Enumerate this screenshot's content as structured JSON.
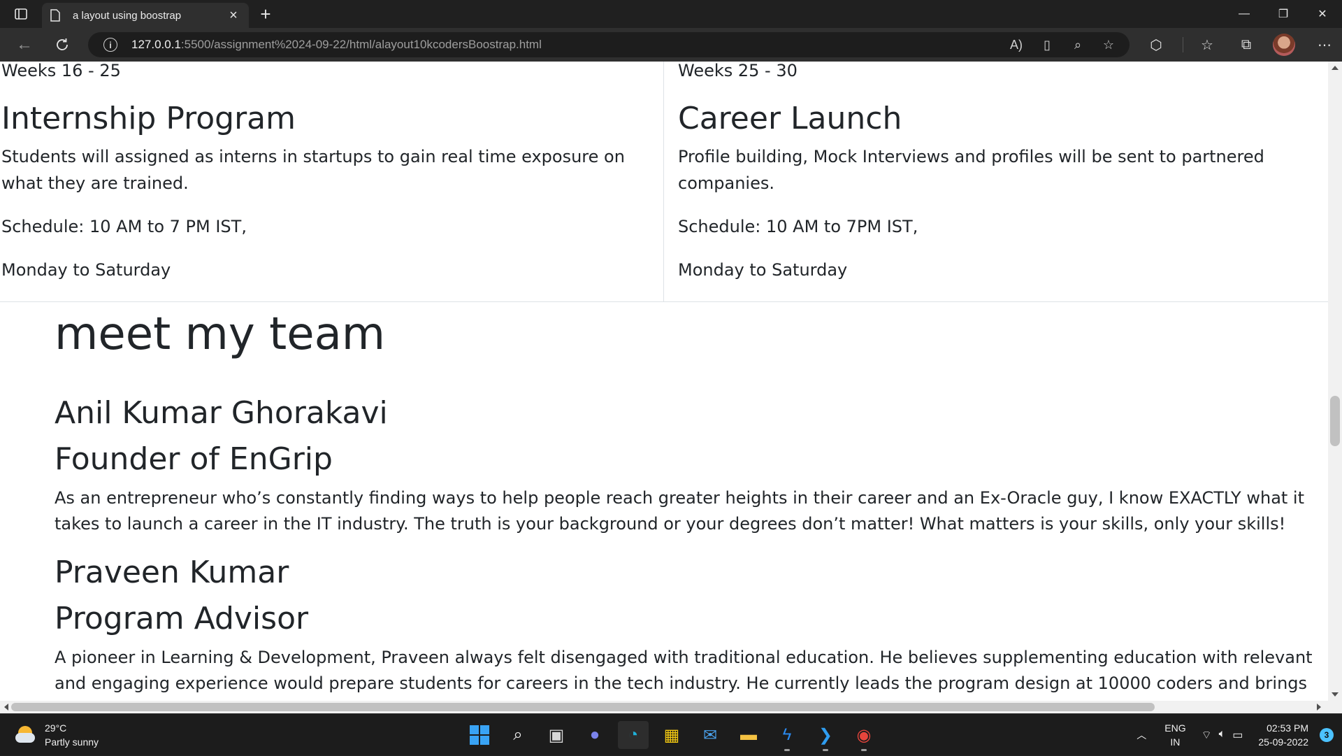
{
  "browser": {
    "tab_title": "a layout using boostrap",
    "url_host": "127.0.0.1",
    "url_rest": ":5500/assignment%2024-09-22/html/alayout10kcodersBoostrap.html"
  },
  "page": {
    "left_col": {
      "weeks": "Weeks 16 - 25",
      "heading": "Internship Program",
      "description": "Students will assigned as interns in startups to gain real time exposure on what they are trained.",
      "schedule": "Schedule: 10 AM to 7 PM IST,",
      "days": "Monday to Saturday"
    },
    "right_col": {
      "weeks": "Weeks 25 - 30",
      "heading": "Career Launch",
      "description": "Profile building, Mock Interviews and profiles will be sent to partnered companies.",
      "schedule": "Schedule: 10 AM to 7PM IST,",
      "days": "Monday to Saturday"
    },
    "team_heading": "meet my team",
    "members": [
      {
        "name": "Anil Kumar Ghorakavi",
        "role": "Founder of EnGrip",
        "bio": "As an entrepreneur who’s constantly finding ways to help people reach greater heights in their career and an Ex-Oracle guy, I know EXACTLY what it takes to launch a career in the IT industry. The truth is your background or your degrees don’t matter! What matters is your skills, only your skills!"
      },
      {
        "name": "Praveen Kumar",
        "role": "Program Advisor",
        "bio": "A pioneer in Learning & Development, Praveen always felt disengaged with traditional education. He believes supplementing education with relevant and engaging experience would prepare students for careers in the tech industry. He currently leads the program design at 10000 coders and brings in all his"
      }
    ]
  },
  "taskbar": {
    "weather_temp": "29°C",
    "weather_desc": "Partly sunny",
    "lang_top": "ENG",
    "lang_bottom": "IN",
    "time": "02:53 PM",
    "date": "25-09-2022",
    "notification_count": "3"
  },
  "colors": {
    "accent": "#4cc2ff",
    "page_text": "#212529",
    "border": "#dee2e6"
  }
}
